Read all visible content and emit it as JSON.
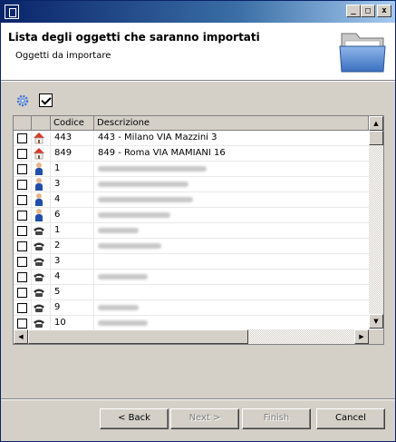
{
  "window": {
    "minimize_glyph": "_",
    "maximize_glyph": "□",
    "close_glyph": "x"
  },
  "header": {
    "title": "Lista degli oggetti che saranno importati",
    "subtitle": "Oggetti da importare"
  },
  "toolbar": {
    "settings_icon": "gear-icon",
    "select_all_checked": true
  },
  "table": {
    "columns": [
      "",
      "",
      "Codice",
      "Descrizione"
    ],
    "rows": [
      {
        "icon": "house-icon",
        "code": "443",
        "description": "443 - Milano VIA Mazzini 3",
        "checked": false
      },
      {
        "icon": "house-icon",
        "code": "849",
        "description": "849 - Roma VIA MAMIANI 16",
        "checked": false
      },
      {
        "icon": "person-icon",
        "code": "1",
        "description": "",
        "checked": false
      },
      {
        "icon": "person-icon",
        "code": "3",
        "description": "",
        "checked": false
      },
      {
        "icon": "person-icon",
        "code": "4",
        "description": "",
        "checked": false
      },
      {
        "icon": "person-icon",
        "code": "6",
        "description": "",
        "checked": false
      },
      {
        "icon": "phone-icon",
        "code": "1",
        "description": "",
        "checked": false
      },
      {
        "icon": "phone-icon",
        "code": "2",
        "description": "",
        "checked": false
      },
      {
        "icon": "phone-icon",
        "code": "3",
        "description": "",
        "checked": false
      },
      {
        "icon": "phone-icon",
        "code": "4",
        "description": "",
        "checked": false
      },
      {
        "icon": "phone-icon",
        "code": "5",
        "description": "",
        "checked": false
      },
      {
        "icon": "phone-icon",
        "code": "9",
        "description": "",
        "checked": false
      },
      {
        "icon": "phone-icon",
        "code": "10",
        "description": "",
        "checked": false
      }
    ]
  },
  "buttons": {
    "back": "< Back",
    "next": "Next >",
    "finish": "Finish",
    "cancel": "Cancel"
  },
  "colors": {
    "titlebar_start": "#0a246a",
    "titlebar_end": "#a6caf0",
    "house_roof": "#d83b2b",
    "person_body": "#1f4fa8"
  }
}
